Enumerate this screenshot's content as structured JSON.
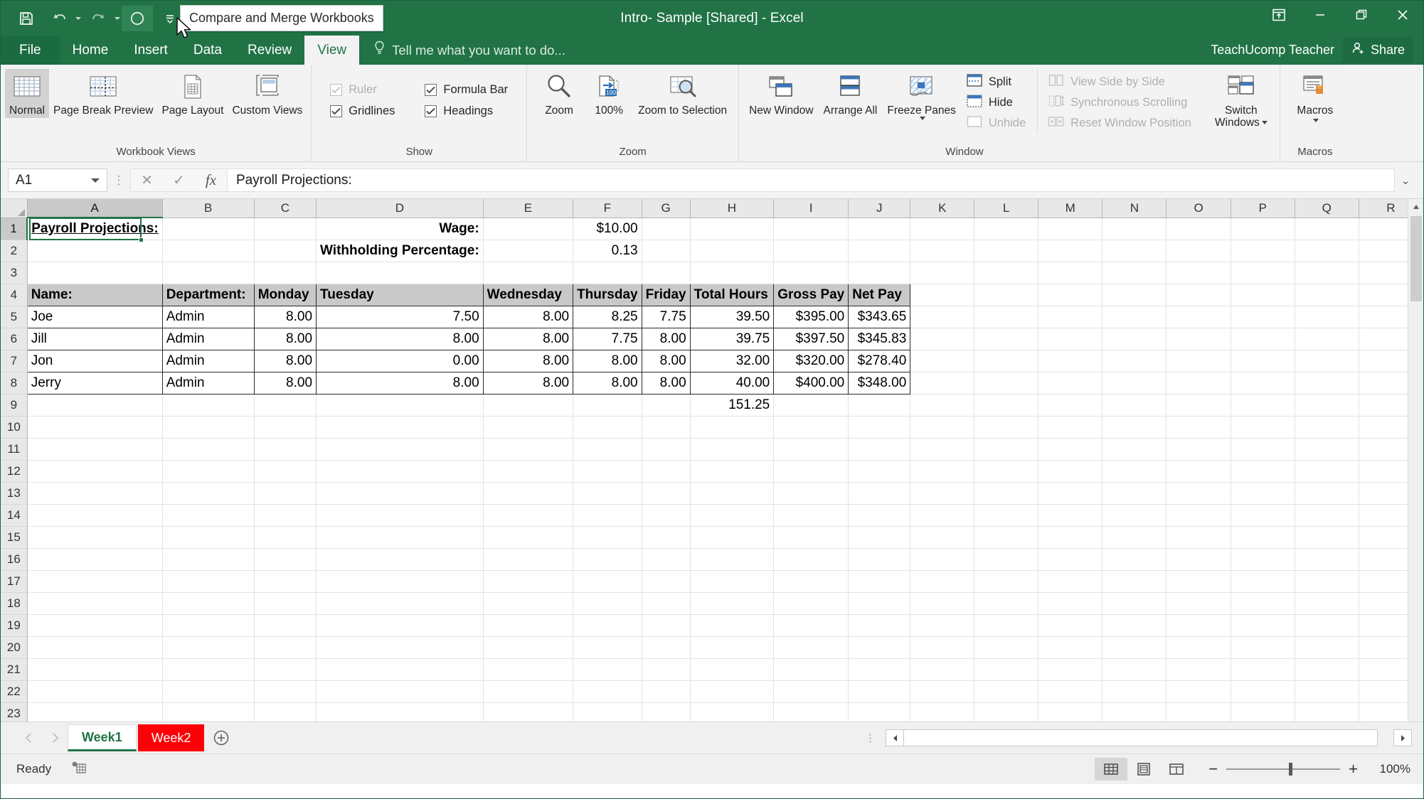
{
  "titlebar": {
    "title": "Intro- Sample  [Shared] - Excel",
    "quick_access": [
      {
        "name": "save",
        "icon": "save-icon"
      },
      {
        "name": "undo",
        "icon": "undo-icon"
      },
      {
        "name": "redo",
        "icon": "redo-icon"
      },
      {
        "name": "compare-and-merge-workbooks",
        "icon": "circle-icon"
      },
      {
        "name": "customize-quick-access-toolbar",
        "icon": "chevron-down-icon"
      }
    ],
    "window_buttons": [
      "ribbon-display-options",
      "minimize",
      "restore",
      "close"
    ]
  },
  "tooltip": {
    "text": "Compare and Merge Workbooks"
  },
  "ribbon_tabs": [
    {
      "label": "File",
      "selected": false
    },
    {
      "label": "Home",
      "selected": false
    },
    {
      "label": "Insert",
      "selected": false
    },
    {
      "label": "Data",
      "selected": false
    },
    {
      "label": "Review",
      "selected": false
    },
    {
      "label": "View",
      "selected": true
    }
  ],
  "tellme": {
    "placeholder": "Tell me what you want to do..."
  },
  "account": {
    "user": "TeachUcomp Teacher",
    "share_label": "Share"
  },
  "ribbon": {
    "groups": [
      {
        "name": "Workbook Views",
        "buttons": [
          {
            "label": "Normal",
            "selected": true,
            "icon": "normal-view-icon"
          },
          {
            "label": "Page Break Preview",
            "selected": false,
            "icon": "page-break-preview-icon"
          },
          {
            "label": "Page Layout",
            "selected": false,
            "icon": "page-layout-icon"
          },
          {
            "label": "Custom Views",
            "selected": false,
            "icon": "custom-views-icon"
          }
        ]
      },
      {
        "name": "Show",
        "checkboxes": [
          {
            "label": "Ruler",
            "checked": true,
            "disabled": true
          },
          {
            "label": "Formula Bar",
            "checked": true,
            "disabled": false
          },
          {
            "label": "Gridlines",
            "checked": true,
            "disabled": false
          },
          {
            "label": "Headings",
            "checked": true,
            "disabled": false
          }
        ]
      },
      {
        "name": "Zoom",
        "buttons": [
          {
            "label": "Zoom",
            "icon": "magnifier-icon"
          },
          {
            "label": "100%",
            "icon": "zoom-100-icon"
          },
          {
            "label": "Zoom to Selection",
            "icon": "zoom-to-selection-icon"
          }
        ]
      },
      {
        "name": "Window",
        "buttons": [
          {
            "label": "New Window",
            "icon": "new-window-icon"
          },
          {
            "label": "Arrange All",
            "icon": "arrange-all-icon"
          },
          {
            "label": "Freeze Panes",
            "icon": "freeze-panes-icon",
            "has_dropdown": true
          }
        ],
        "small_buttons": [
          {
            "label": "Split",
            "disabled": false,
            "icon": "split-icon"
          },
          {
            "label": "Hide",
            "disabled": false,
            "icon": "hide-icon"
          },
          {
            "label": "Unhide",
            "disabled": true,
            "icon": "unhide-icon"
          },
          {
            "label": "View Side by Side",
            "disabled": true,
            "icon": "view-side-by-side-icon"
          },
          {
            "label": "Synchronous Scrolling",
            "disabled": true,
            "icon": "synchronous-scrolling-icon"
          },
          {
            "label": "Reset Window Position",
            "disabled": true,
            "icon": "reset-window-position-icon"
          }
        ]
      },
      {
        "name": "Macros",
        "buttons": [
          {
            "label": "Macros",
            "icon": "macros-icon",
            "has_dropdown": true
          }
        ]
      }
    ]
  },
  "formula_bar": {
    "name_box": "A1",
    "cancel_icon": "close-icon",
    "enter_icon": "check-icon",
    "function_icon": "fx-icon",
    "value": "Payroll Projections:"
  },
  "grid": {
    "columns": [
      "A",
      "B",
      "C",
      "D",
      "E",
      "F",
      "G",
      "H",
      "I",
      "J",
      "K",
      "L",
      "M",
      "N",
      "O",
      "P",
      "Q",
      "R"
    ],
    "rows": [
      1,
      2,
      3,
      4,
      5,
      6,
      7,
      8,
      9,
      10,
      11,
      12,
      13,
      14,
      15,
      16,
      17,
      18,
      19,
      20,
      21,
      22,
      23
    ],
    "selected_cell": "A1",
    "cells": {
      "A1": "Payroll Projections:",
      "D1": "Wage:",
      "F1": "$10.00",
      "D2": "Withholding Percentage:",
      "F2": "0.13",
      "A4": "Name:",
      "B4": "Department:",
      "C4": "Monday",
      "D4": "Tuesday",
      "E4": "Wednesday",
      "F4": "Thursday",
      "G4": "Friday",
      "H4": "Total Hours",
      "I4": "Gross Pay",
      "J4": "Net Pay",
      "A5": "Joe",
      "B5": "Admin",
      "C5": "8.00",
      "D5": "7.50",
      "E5": "8.00",
      "F5": "8.25",
      "G5": "7.75",
      "H5": "39.50",
      "I5": "$395.00",
      "J5": "$343.65",
      "A6": "Jill",
      "B6": "Admin",
      "C6": "8.00",
      "D6": "8.00",
      "E6": "8.00",
      "F6": "7.75",
      "G6": "8.00",
      "H6": "39.75",
      "I6": "$397.50",
      "J6": "$345.83",
      "A7": "Jon",
      "B7": "Admin",
      "C7": "8.00",
      "D7": "0.00",
      "E7": "8.00",
      "F7": "8.00",
      "G7": "8.00",
      "H7": "32.00",
      "I7": "$320.00",
      "J7": "$278.40",
      "A8": "Jerry",
      "B8": "Admin",
      "C8": "8.00",
      "D8": "8.00",
      "E8": "8.00",
      "F8": "8.00",
      "G8": "8.00",
      "H8": "40.00",
      "I8": "$400.00",
      "J8": "$348.00",
      "H9": "151.25"
    }
  },
  "sheet_tabs": {
    "tabs": [
      {
        "label": "Week1",
        "active": true,
        "color": null
      },
      {
        "label": "Week2",
        "active": false,
        "color": "#fb0007"
      }
    ],
    "add_label": "+",
    "prev_icon": "chevron-left-icon",
    "next_icon": "chevron-right-icon"
  },
  "status_bar": {
    "state": "Ready",
    "macro_icon": "record-macro-icon",
    "views": [
      {
        "name": "normal-view",
        "active": true
      },
      {
        "name": "page-layout-view",
        "active": false
      },
      {
        "name": "page-break-preview",
        "active": false
      }
    ],
    "zoom_out": "−",
    "zoom_in": "+",
    "zoom_level": "100%"
  },
  "colors": {
    "brand_green": "#217346",
    "ribbon_bg": "#f3f3f3",
    "tab2_red": "#fb0007"
  }
}
